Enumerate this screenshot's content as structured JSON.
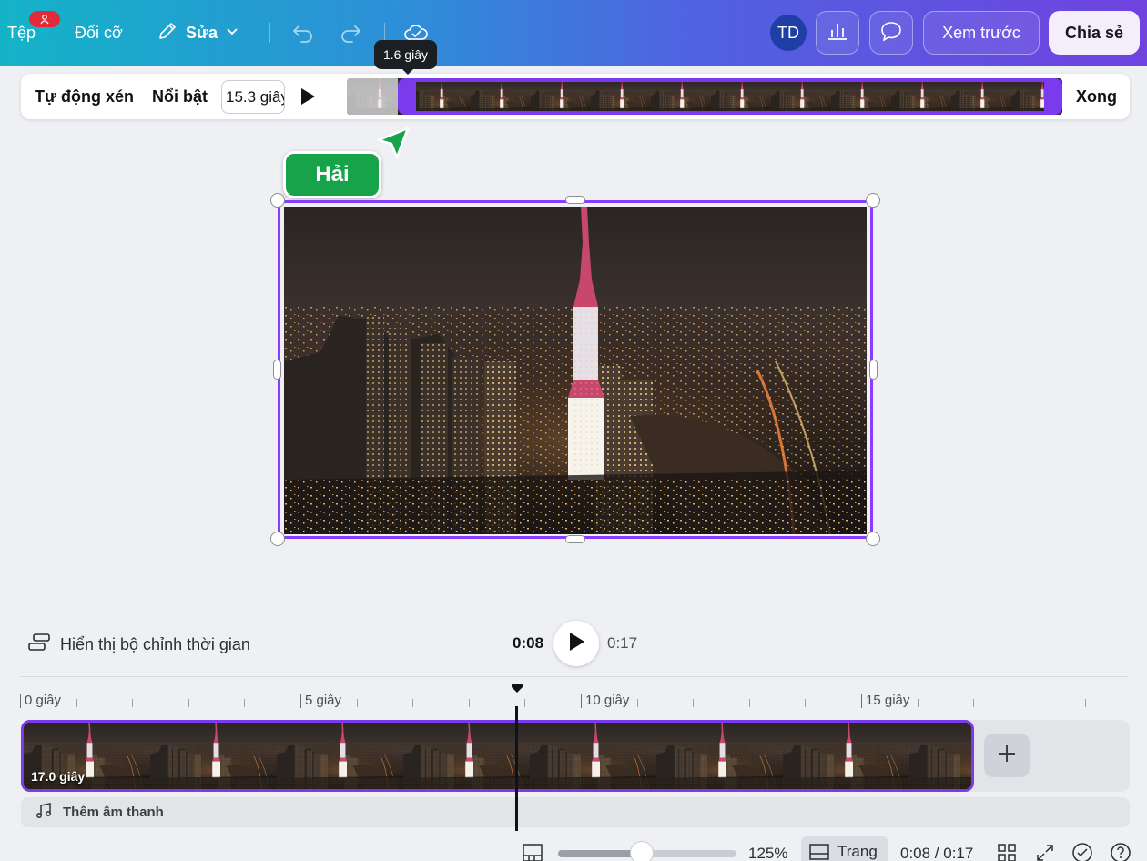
{
  "topbar": {
    "file_label": "Tệp",
    "resize_label": "Đổi cỡ",
    "edit_label": "Sửa",
    "avatar_initials": "TD",
    "preview_label": "Xem trước",
    "share_label": "Chia sẻ",
    "gradient_start": "#14b3c7",
    "gradient_end": "#6f43e0"
  },
  "trim": {
    "tooltip": "1.6 giây",
    "auto_trim_label": "Tự động xén",
    "highlight_label": "Nổi bật",
    "duration_value": "15.3 giây",
    "done_label": "Xong",
    "accent": "#7c3aed"
  },
  "collaborator": {
    "name": "Hải",
    "color": "#17a34a"
  },
  "playback": {
    "show_timing_label": "Hiển thị bộ chỉnh thời gian",
    "current_time": "0:08",
    "total_time": "0:17"
  },
  "ruler": {
    "labels": [
      "0 giây",
      "5 giây",
      "10 giây",
      "15 giây"
    ]
  },
  "clip": {
    "duration_label": "17.0 giây"
  },
  "audio": {
    "add_audio_label": "Thêm âm thanh"
  },
  "status": {
    "zoom_percent": "125%",
    "zoom_level": 0.47,
    "pages_label": "Trang",
    "page_time": "0:08 / 0:17"
  }
}
